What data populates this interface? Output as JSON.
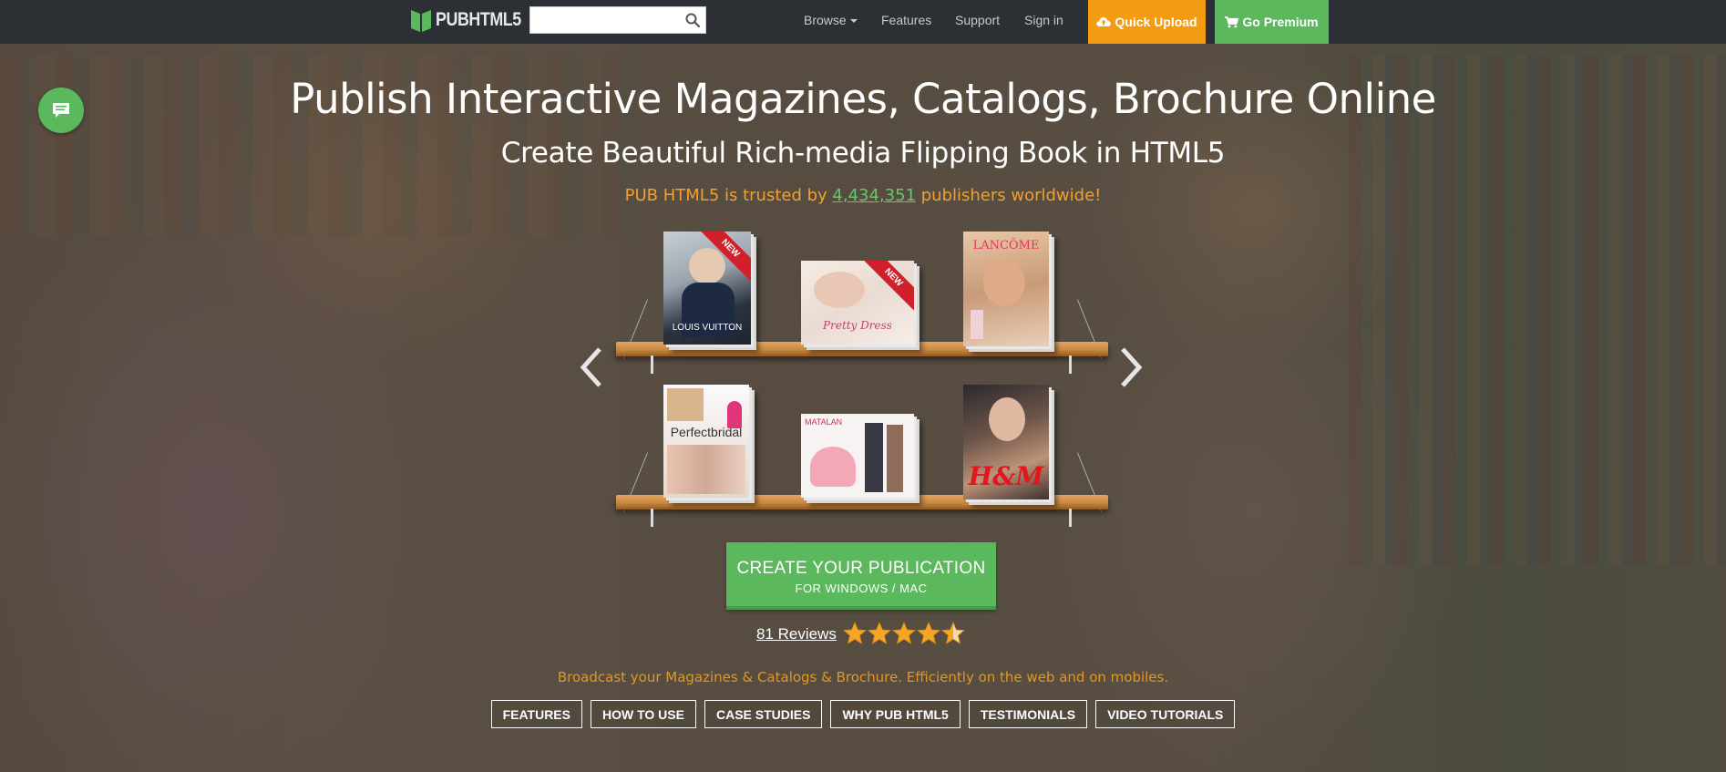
{
  "navbar": {
    "logo_text": "PUBHTML5",
    "search_placeholder": "",
    "links": [
      {
        "label": "Browse"
      },
      {
        "label": "Features"
      },
      {
        "label": "Support"
      },
      {
        "label": "Sign in"
      }
    ],
    "quick_upload": "Quick Upload",
    "go_premium": "Go Premium"
  },
  "hero": {
    "title": "Publish Interactive Magazines, Catalogs, Brochure Online",
    "subtitle": "Create Beautiful Rich-media Flipping Book in HTML5",
    "trust_prefix": "PUB HTML5 is trusted by ",
    "trust_count": "4,434,351",
    "trust_suffix": " publishers worldwide!"
  },
  "books": [
    {
      "name": "LOUIS VUITTON",
      "badge": "NEW"
    },
    {
      "name": "Pretty Dress",
      "badge": "NEW"
    },
    {
      "name": "LANCÔME",
      "badge": ""
    },
    {
      "name": "Perfectbridal",
      "badge": ""
    },
    {
      "name": "MATALAN",
      "badge": ""
    },
    {
      "name": "H&M",
      "badge": ""
    }
  ],
  "cta": {
    "main": "CREATE YOUR PUBLICATION",
    "sub": "FOR WINDOWS / MAC"
  },
  "reviews": {
    "label": "81 Reviews",
    "rating": 4.5,
    "max": 5
  },
  "tagline": "Broadcast your Magazines & Catalogs & Brochure. Efficiently on the web and on mobiles.",
  "pills": [
    "FEATURES",
    "HOW TO USE",
    "CASE STUDIES",
    "WHY PUB HTML5",
    "TESTIMONIALS",
    "VIDEO TUTORIALS"
  ],
  "colors": {
    "navbar": "#2c2f33",
    "accent_green": "#5cb85c",
    "accent_orange": "#f39c12",
    "trust_text": "#f0a030"
  },
  "icons": {
    "search": "search-icon",
    "upload": "cloud-upload-icon",
    "cart": "cart-icon",
    "chat": "chat-icon",
    "prev": "chevron-left-icon",
    "next": "chevron-right-icon"
  }
}
